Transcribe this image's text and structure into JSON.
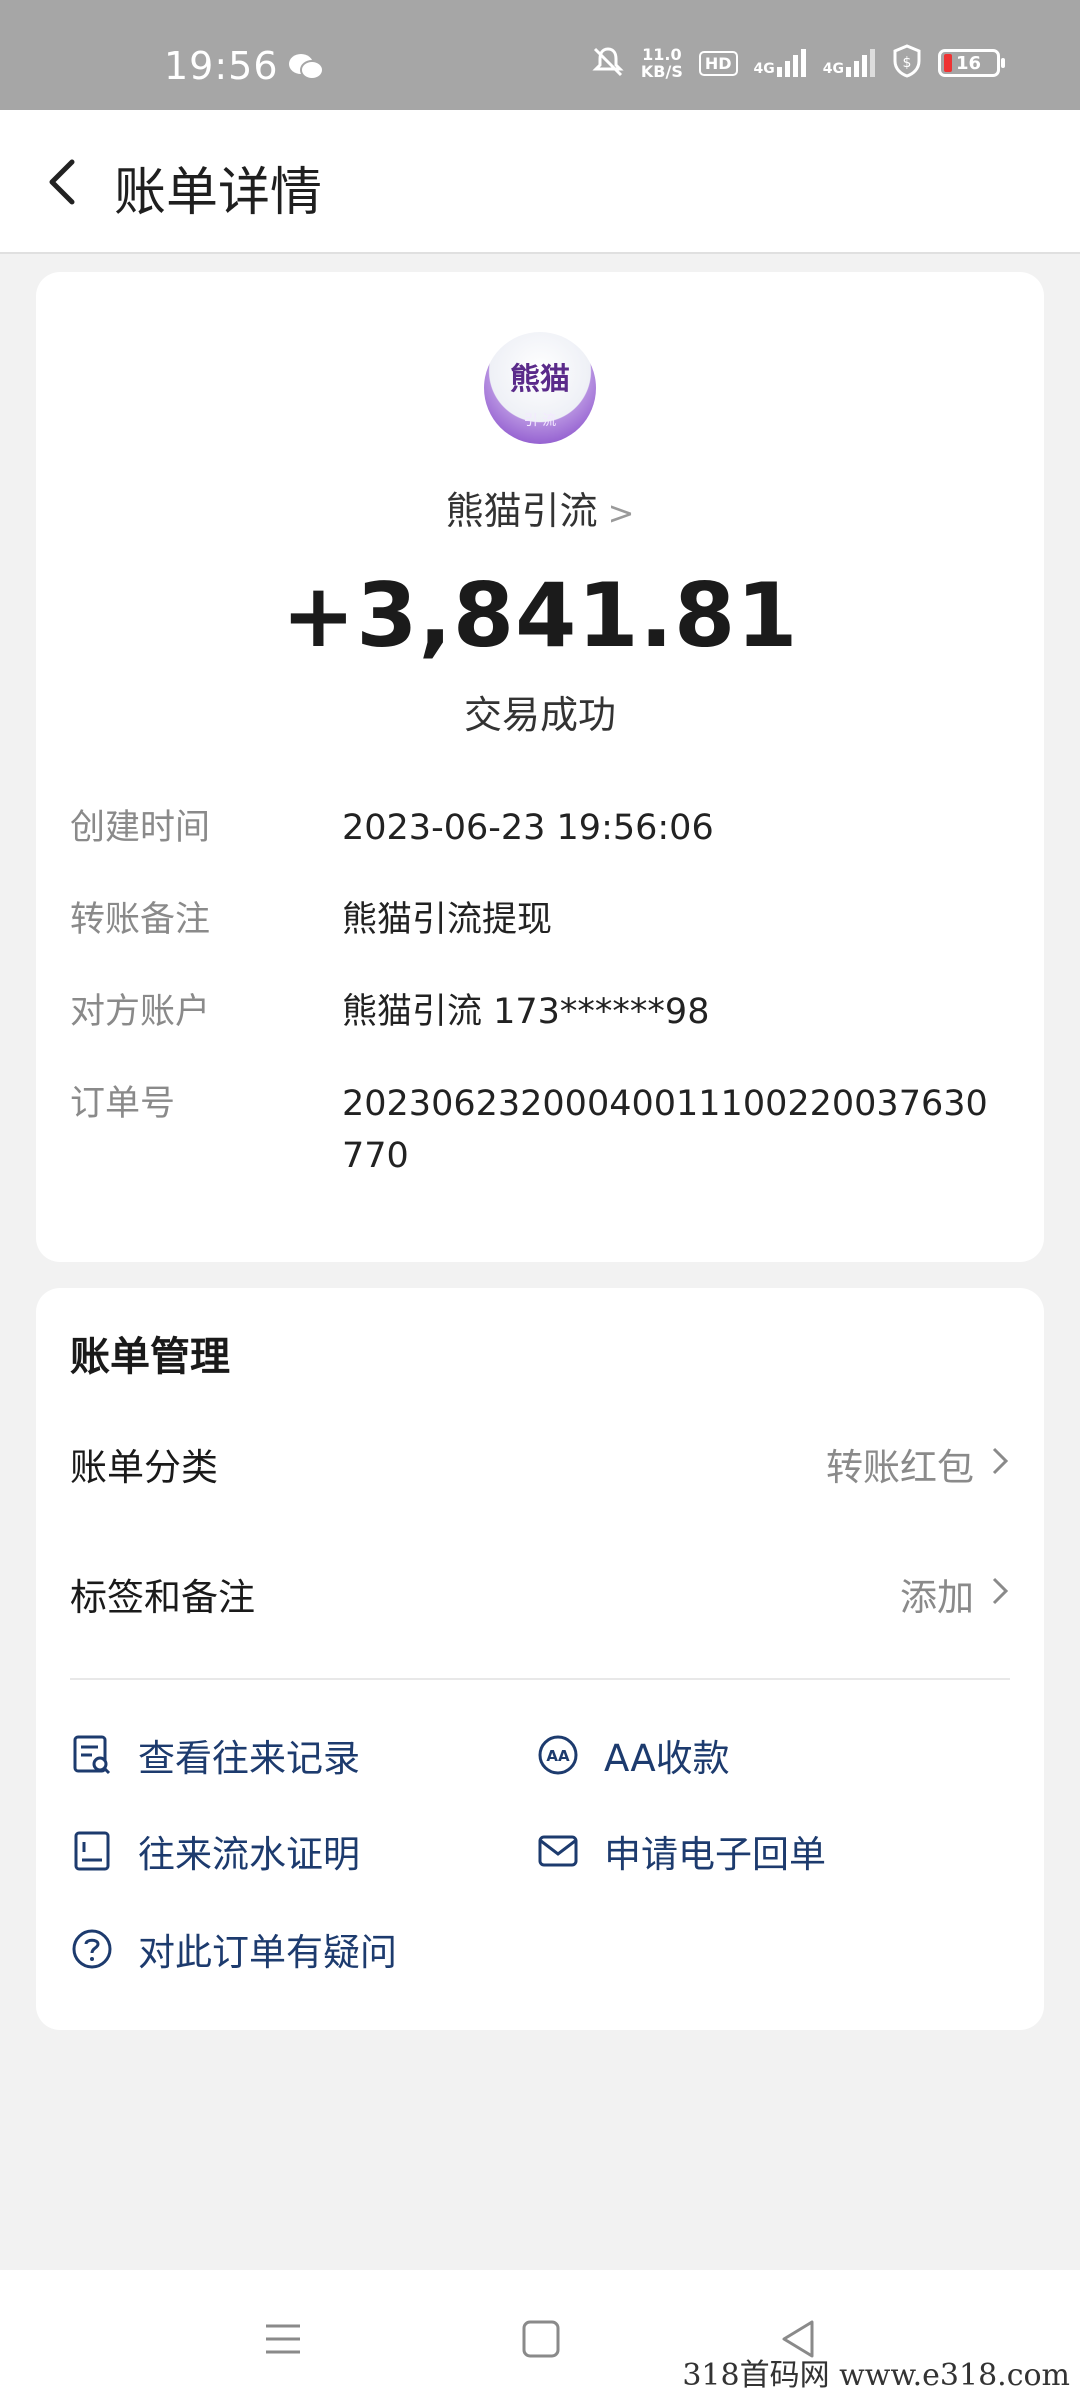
{
  "status_bar": {
    "time": "19:56",
    "speed_value": "11.0",
    "speed_unit": "KB/S",
    "hd_badge": "HD",
    "net1": "4G",
    "net2": "4G",
    "battery": "16",
    "icons": [
      "wechat-icon",
      "mute-icon",
      "signal-icon",
      "shield-icon",
      "battery-icon"
    ]
  },
  "header": {
    "title": "账单详情"
  },
  "summary": {
    "payee": "熊猫引流",
    "avatar_text_top": "熊猫",
    "avatar_text_bottom": "引 流",
    "amount": "+3,841.81",
    "status": "交易成功"
  },
  "details": [
    {
      "label": "创建时间",
      "value": "2023-06-23 19:56:06"
    },
    {
      "label": "转账备注",
      "value": "熊猫引流提现"
    },
    {
      "label": "对方账户",
      "value": "熊猫引流 173******98"
    },
    {
      "label": "订单号",
      "value": "20230623200040011100220037630770"
    }
  ],
  "management": {
    "title": "账单管理",
    "category_label": "账单分类",
    "category_value": "转账红包",
    "tags_label": "标签和备注",
    "tags_value": "添加",
    "actions": [
      {
        "label": "查看往来记录",
        "icon": "record-icon"
      },
      {
        "label": "AA收款",
        "icon": "aa-icon"
      },
      {
        "label": "往来流水证明",
        "icon": "statement-icon"
      },
      {
        "label": "申请电子回单",
        "icon": "mail-icon"
      },
      {
        "label": "对此订单有疑问",
        "icon": "question-icon"
      }
    ]
  },
  "watermark": "318首码网 www.e318.com",
  "colors": {
    "link": "#1d3b6e",
    "muted": "#8a8a8a",
    "statusbar": "#a6a6a6"
  }
}
